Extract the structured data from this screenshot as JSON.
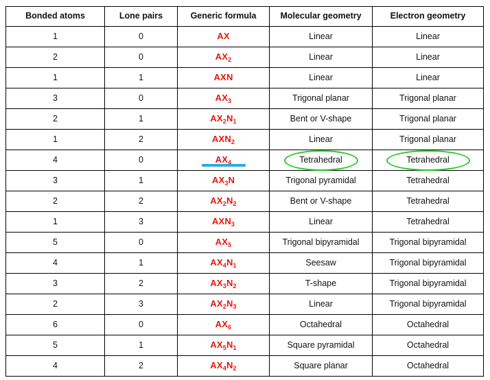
{
  "table": {
    "headers": [
      "Bonded atoms",
      "Lone pairs",
      "Generic formula",
      "Molecular geometry",
      "Electron geometry"
    ],
    "rows": [
      {
        "bonded": "1",
        "lone": "0",
        "formula_base": "AX",
        "formula_sub1": "",
        "formula_n": "",
        "formula_sub2": "",
        "molecular": "Linear",
        "electron": "Linear"
      },
      {
        "bonded": "2",
        "lone": "0",
        "formula_base": "AX",
        "formula_sub1": "2",
        "formula_n": "",
        "formula_sub2": "",
        "molecular": "Linear",
        "electron": "Linear"
      },
      {
        "bonded": "1",
        "lone": "1",
        "formula_base": "AX",
        "formula_sub1": "",
        "formula_n": "N",
        "formula_sub2": "",
        "molecular": "Linear",
        "electron": "Linear"
      },
      {
        "bonded": "3",
        "lone": "0",
        "formula_base": "AX",
        "formula_sub1": "3",
        "formula_n": "",
        "formula_sub2": "",
        "molecular": "Trigonal planar",
        "electron": "Trigonal planar"
      },
      {
        "bonded": "2",
        "lone": "1",
        "formula_base": "AX",
        "formula_sub1": "2",
        "formula_n": "N",
        "formula_sub2": "1",
        "molecular": "Bent or V-shape",
        "electron": "Trigonal planar"
      },
      {
        "bonded": "1",
        "lone": "2",
        "formula_base": "AX",
        "formula_sub1": "",
        "formula_n": "N",
        "formula_sub2": "2",
        "molecular": "Linear",
        "electron": "Trigonal planar"
      },
      {
        "bonded": "4",
        "lone": "0",
        "formula_base": "AX",
        "formula_sub1": "4",
        "formula_n": "",
        "formula_sub2": "",
        "molecular": "Tetrahedral",
        "electron": "Tetrahedral",
        "formula_underlined": true,
        "molecular_circled": true,
        "electron_circled": true
      },
      {
        "bonded": "3",
        "lone": "1",
        "formula_base": "AX",
        "formula_sub1": "3",
        "formula_n": "N",
        "formula_sub2": "",
        "molecular": "Trigonal pyramidal",
        "electron": "Tetrahedral"
      },
      {
        "bonded": "2",
        "lone": "2",
        "formula_base": "AX",
        "formula_sub1": "2",
        "formula_n": "N",
        "formula_sub2": "2",
        "molecular": "Bent or V-shape",
        "electron": "Tetrahedral"
      },
      {
        "bonded": "1",
        "lone": "3",
        "formula_base": "AX",
        "formula_sub1": "",
        "formula_n": "N",
        "formula_sub2": "3",
        "molecular": "Linear",
        "electron": "Tetrahedral"
      },
      {
        "bonded": "5",
        "lone": "0",
        "formula_base": "AX",
        "formula_sub1": "5",
        "formula_n": "",
        "formula_sub2": "",
        "molecular": "Trigonal bipyramidal",
        "electron": "Trigonal bipyramidal"
      },
      {
        "bonded": "4",
        "lone": "1",
        "formula_base": "AX",
        "formula_sub1": "4",
        "formula_n": "N",
        "formula_sub2": "1",
        "molecular": "Seesaw",
        "electron": "Trigonal bipyramidal"
      },
      {
        "bonded": "3",
        "lone": "2",
        "formula_base": "AX",
        "formula_sub1": "3",
        "formula_n": "N",
        "formula_sub2": "2",
        "molecular": "T-shape",
        "electron": "Trigonal bipyramidal"
      },
      {
        "bonded": "2",
        "lone": "3",
        "formula_base": "AX",
        "formula_sub1": "2",
        "formula_n": "N",
        "formula_sub2": "3",
        "molecular": "Linear",
        "electron": "Trigonal bipyramidal"
      },
      {
        "bonded": "6",
        "lone": "0",
        "formula_base": "AX",
        "formula_sub1": "6",
        "formula_n": "",
        "formula_sub2": "",
        "molecular": "Octahedral",
        "electron": "Octahedral"
      },
      {
        "bonded": "5",
        "lone": "1",
        "formula_base": "AX",
        "formula_sub1": "5",
        "formula_n": "N",
        "formula_sub2": "1",
        "molecular": "Square pyramidal",
        "electron": "Octahedral"
      },
      {
        "bonded": "4",
        "lone": "2",
        "formula_base": "AX",
        "formula_sub1": "4",
        "formula_n": "N",
        "formula_sub2": "2",
        "molecular": "Square planar",
        "electron": "Octahedral"
      }
    ]
  },
  "annotations": {
    "highlight_color": "#29ABE2",
    "circle_color": "#22CC22",
    "formula_color": "#E8160C",
    "border_color": "#000000",
    "text_color": "#111111",
    "background_color": "#FFFFFF"
  }
}
